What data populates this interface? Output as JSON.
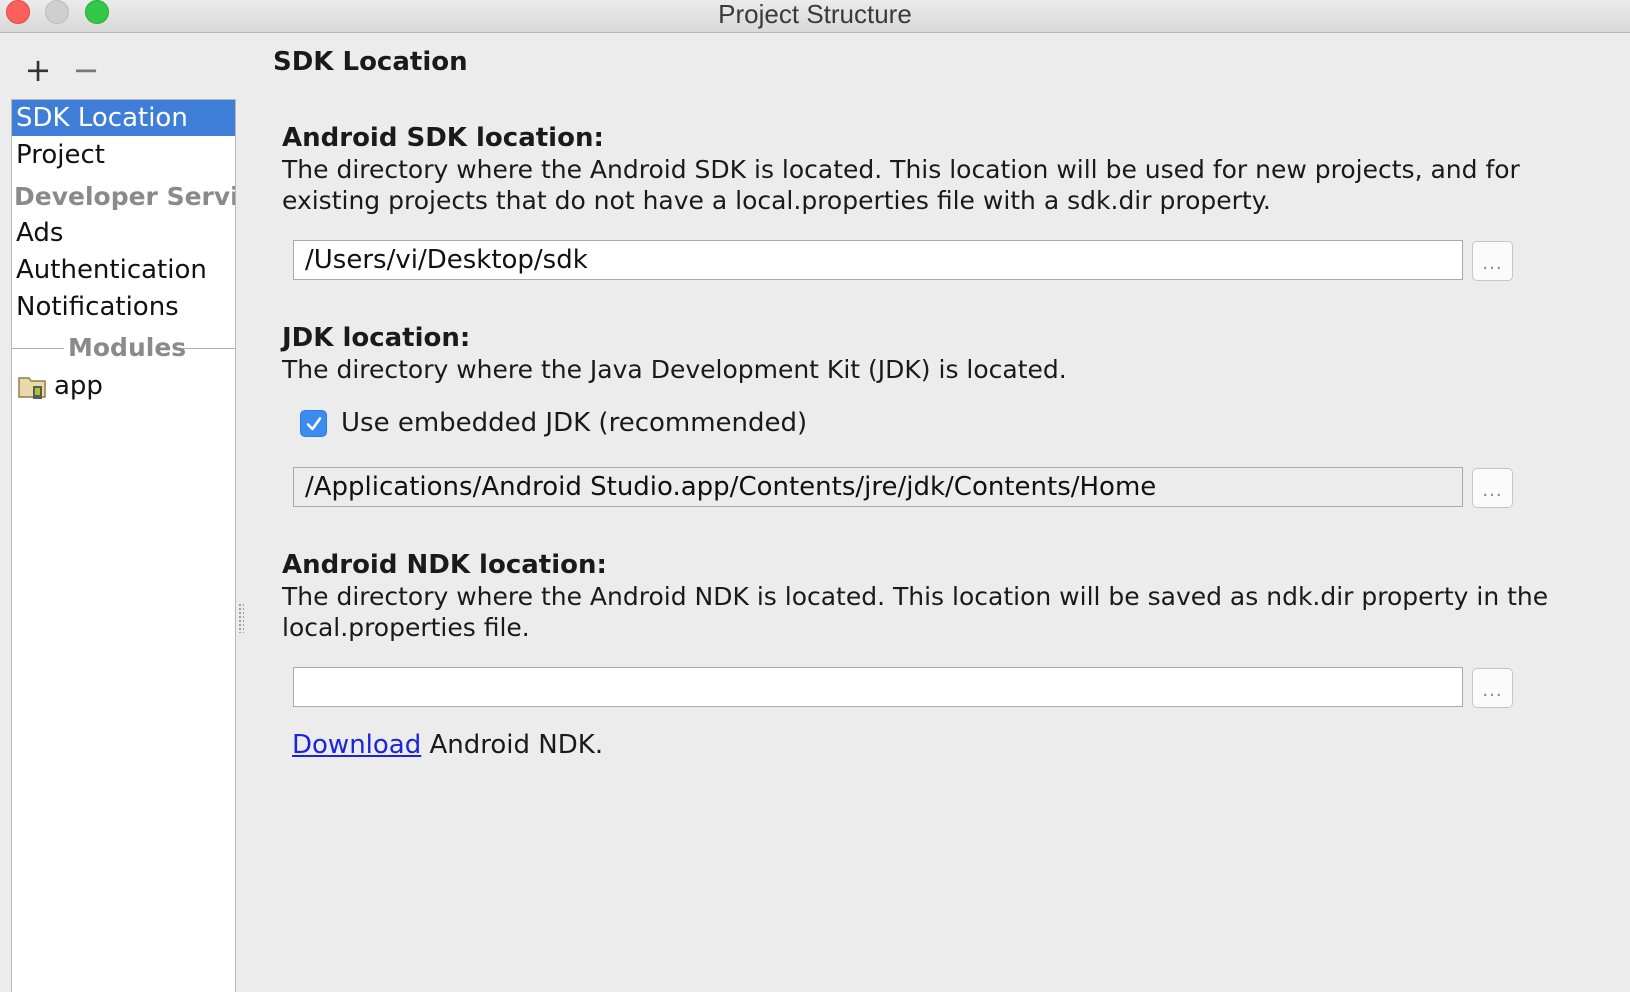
{
  "window": {
    "title": "Project Structure"
  },
  "toolbar": {
    "add_label": "+",
    "remove_label": "−"
  },
  "sidebar": {
    "items": [
      {
        "label": "SDK Location",
        "selected": true
      },
      {
        "label": "Project"
      }
    ],
    "group_label": "Developer Servi...",
    "group_items": [
      {
        "label": "Ads"
      },
      {
        "label": "Authentication"
      },
      {
        "label": "Notifications"
      }
    ],
    "modules_label": "Modules",
    "modules": [
      {
        "label": "app",
        "icon": "module-folder-icon"
      }
    ]
  },
  "main": {
    "page_title": "SDK Location",
    "sdk": {
      "title": "Android SDK location:",
      "desc_line1": "The directory where the Android SDK is located. This location will be used for new projects, and for",
      "desc_line2": "existing projects that do not have a local.properties file with a sdk.dir property.",
      "value": "/Users/vi/Desktop/sdk",
      "browse_label": "..."
    },
    "jdk": {
      "title": "JDK location:",
      "desc": "The directory where the Java Development Kit (JDK) is located.",
      "checkbox_label": "Use embedded JDK (recommended)",
      "checkbox_checked": true,
      "value": "/Applications/Android Studio.app/Contents/jre/jdk/Contents/Home",
      "browse_label": "..."
    },
    "ndk": {
      "title": "Android NDK location:",
      "desc_line1": "The directory where the Android NDK is located. This location will be saved as ndk.dir property in the",
      "desc_line2": "local.properties file.",
      "value": "",
      "browse_label": "...",
      "download_link": "Download",
      "download_suffix": " Android NDK."
    }
  },
  "colors": {
    "selection": "#3e7ed8",
    "checkbox": "#3c8cf0",
    "link": "#1a24d8"
  }
}
